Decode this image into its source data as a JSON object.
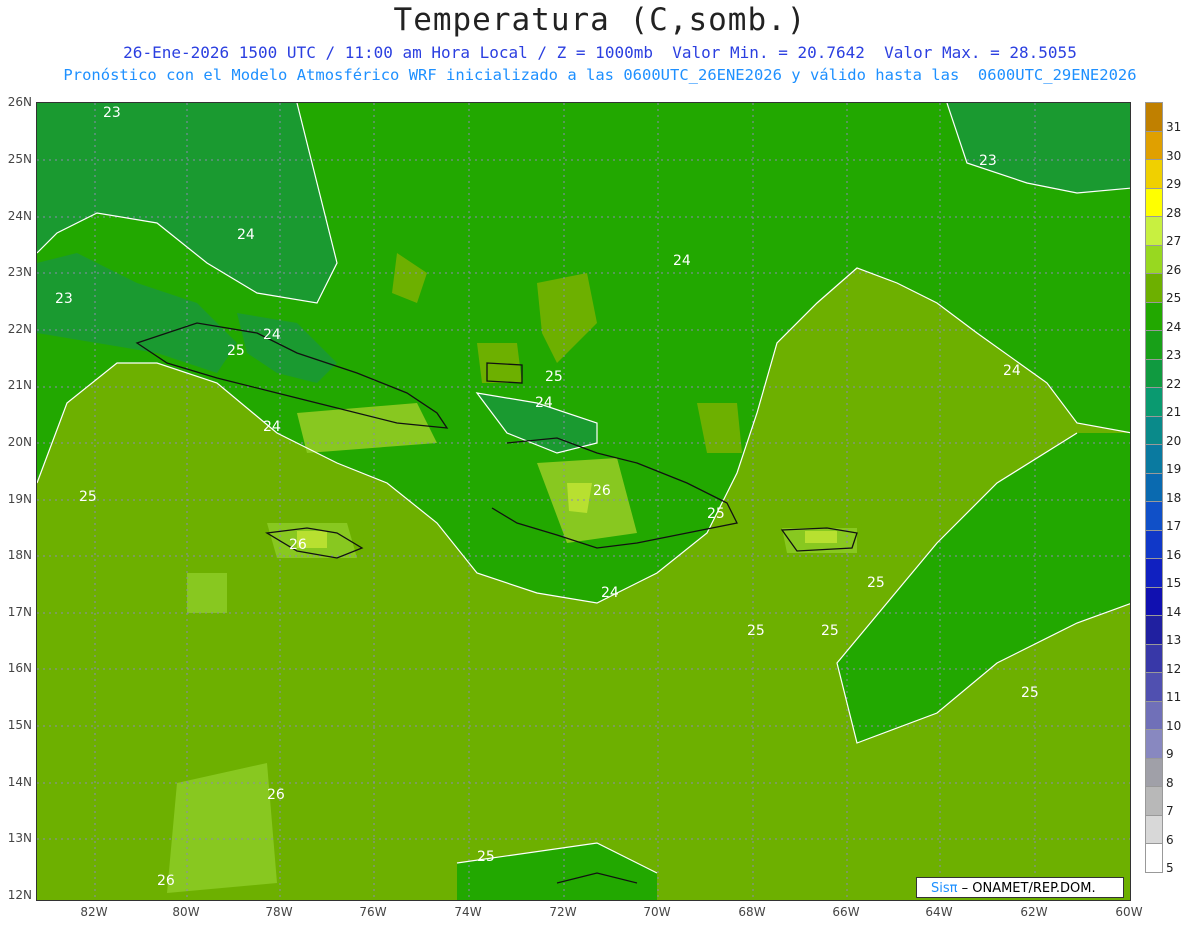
{
  "header": {
    "title": "Temperatura (C,somb.)",
    "line1": "26-Ene-2026 1500 UTC / 11:00 am Hora Local / Z = 1000mb  Valor Min. = 20.7642  Valor Max. = 28.5055",
    "line2": "Pronóstico con el Modelo Atmosférico WRF inicializado a las 0600UTC_26ENE2026 y válido hasta las  0600UTC_29ENE2026"
  },
  "map": {
    "lat_labels": [
      "26N",
      "25N",
      "24N",
      "23N",
      "22N",
      "21N",
      "20N",
      "19N",
      "18N",
      "17N",
      "16N",
      "15N",
      "14N",
      "13N",
      "12N"
    ],
    "lon_labels": [
      "82W",
      "80W",
      "78W",
      "76W",
      "74W",
      "72W",
      "70W",
      "68W",
      "66W",
      "64W",
      "62W",
      "60W"
    ],
    "contour_labels": [
      "23",
      "24",
      "25",
      "26",
      "23",
      "24",
      "25",
      "24",
      "25",
      "26",
      "25",
      "24",
      "25",
      "23",
      "24",
      "25",
      "24",
      "25",
      "26",
      "25",
      "24",
      "25",
      "26"
    ],
    "colors": {
      "t25": "#6db000",
      "t24": "#22a800",
      "t23": "#1a9a30",
      "t26": "#88c820",
      "t27": "#b8e030"
    }
  },
  "colorbar": {
    "levels": [
      "31",
      "30",
      "29",
      "28",
      "27",
      "26",
      "25",
      "24",
      "23",
      "22",
      "21",
      "20",
      "19",
      "18",
      "17",
      "16",
      "15",
      "14",
      "13",
      "12",
      "11",
      "10",
      "9",
      "8",
      "7",
      "6",
      "5"
    ],
    "colors": [
      "#c08000",
      "#e0a000",
      "#f0d000",
      "#ffff00",
      "#c8f040",
      "#98d820",
      "#6db000",
      "#22a800",
      "#18a018",
      "#109a40",
      "#0a9a70",
      "#0a8a8a",
      "#0a7aa0",
      "#0a6ab0",
      "#1050c8",
      "#1038c8",
      "#1020c0",
      "#1010b0",
      "#2020a0",
      "#3838a8",
      "#5050b0",
      "#7070b8",
      "#8888c0",
      "#a0a0a8",
      "#b8b8b8",
      "#d8d8d8",
      "#ffffff"
    ]
  },
  "credit": {
    "brand": "Sisπ",
    "org": "– ONAMET/REP.DOM."
  }
}
